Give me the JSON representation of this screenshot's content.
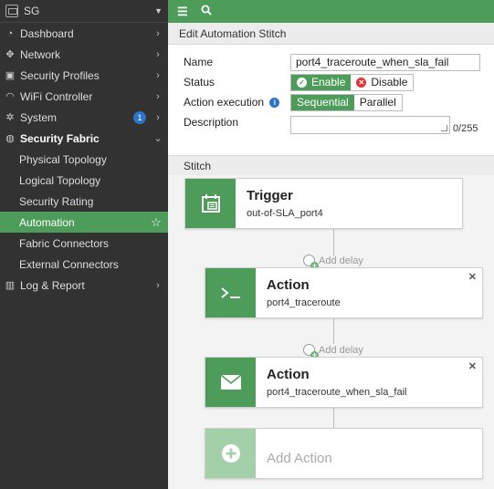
{
  "device": {
    "name": "SG"
  },
  "sidebar": {
    "items": [
      {
        "label": "Dashboard",
        "icon": "dashboard-icon"
      },
      {
        "label": "Network",
        "icon": "network-icon"
      },
      {
        "label": "Security Profiles",
        "icon": "lock-icon"
      },
      {
        "label": "WiFi Controller",
        "icon": "wifi-icon"
      },
      {
        "label": "System",
        "icon": "gear-icon",
        "badge": "1"
      },
      {
        "label": "Security Fabric",
        "icon": "fabric-icon"
      },
      {
        "label": "Physical Topology"
      },
      {
        "label": "Logical Topology"
      },
      {
        "label": "Security Rating"
      },
      {
        "label": "Automation"
      },
      {
        "label": "Fabric Connectors"
      },
      {
        "label": "External Connectors"
      },
      {
        "label": "Log & Report",
        "icon": "chart-icon"
      }
    ]
  },
  "panel": {
    "title": "Edit Automation Stitch"
  },
  "form": {
    "name_label": "Name",
    "name_value": "port4_traceroute_when_sla_fail",
    "status_label": "Status",
    "status_enable": "Enable",
    "status_disable": "Disable",
    "exec_label": "Action execution",
    "exec_sequential": "Sequential",
    "exec_parallel": "Parallel",
    "desc_label": "Description",
    "desc_counter": "0/255"
  },
  "stitch": {
    "section_label": "Stitch",
    "trigger": {
      "title": "Trigger",
      "subtitle": "out-of-SLA_port4"
    },
    "add_delay_1": "Add delay",
    "action1": {
      "title": "Action",
      "subtitle": "port4_traceroute"
    },
    "add_delay_2": "Add delay",
    "action2": {
      "title": "Action",
      "subtitle": "port4_traceroute_when_sla_fail"
    },
    "add_action": "Add Action"
  },
  "colors": {
    "accent": "#4e9c5a",
    "sidebar": "#323232",
    "info": "#2a75c7"
  }
}
